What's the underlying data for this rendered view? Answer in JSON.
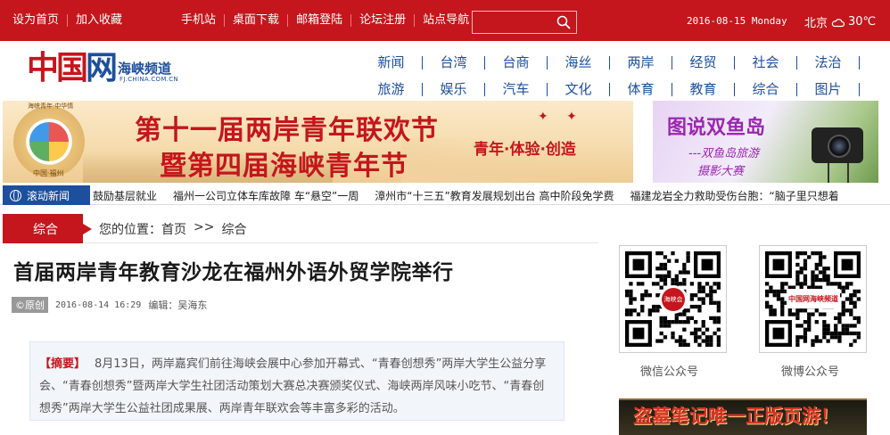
{
  "topbar": {
    "links_left": [
      "设为首页",
      "加入收藏"
    ],
    "links_right": [
      "手机站",
      "桌面下载",
      "邮箱登陆",
      "论坛注册",
      "站点导航"
    ],
    "search_placeholder": "",
    "date": "2016-08-15 Monday",
    "city": "北京",
    "temperature": "30℃",
    "weather_icon": "cloud-icon"
  },
  "logo": {
    "main": "中国",
    "wang": "网",
    "channel": "海峡频道",
    "domain": "FJ.CHINA.COM.CN"
  },
  "nav": {
    "row1": [
      "新闻",
      "台湾",
      "台商",
      "海丝",
      "两岸",
      "经贸",
      "社会",
      "法治"
    ],
    "row2": [
      "旅游",
      "娱乐",
      "汽车",
      "文化",
      "体育",
      "教育",
      "综合",
      "图片"
    ]
  },
  "banner_main": {
    "line1": "第十一届两岸青年联欢节",
    "line2": "暨第四届海峡青年节",
    "slogan": "青年·体验·创造",
    "emblem_top": "海峡青年·中华情",
    "emblem_caption": "中国·福州"
  },
  "banner_side": {
    "title": "图说双鱼岛",
    "sub1": "---双鱼岛旅游",
    "sub2": "摄影大赛"
  },
  "ticker": {
    "label": "滚动新闻",
    "items": [
      "鼓励基层就业",
      "福州一公司立体车库故障 车“悬空”一周",
      "漳州市“十三五”教育发展规划出台 高中阶段免学费",
      "福建龙岩全力救助受伤台胞：“脑子里只想着"
    ]
  },
  "section": {
    "label": "综合",
    "location_prefix": "您的位置：",
    "home": "首页",
    "sep": ">>",
    "current": "综合"
  },
  "article": {
    "title": "首届两岸青年教育沙龙在福州外语外贸学院举行",
    "source": "©原创",
    "time": "2016-08-14 16:29",
    "editor": "编辑：吴海东",
    "summary_label": "【摘要】",
    "summary_text": "8月13日，两岸嘉宾们前往海峡会展中心参加开幕式、“青春创想秀”两岸大学生公益分享会、“青春创想秀”暨两岸大学生社团活动策划大赛总决赛颁奖仪式、海峡两岸风味小吃节、“青春创想秀”两岸大学生公益社团成果展、两岸青年联欢会等丰富多彩的活动。"
  },
  "right": {
    "qr1_caption": "微信公众号",
    "qr2_caption": "微博公众号",
    "qr1_badge": "海峡会",
    "qr2_badge": "中国网海峡频道",
    "ad_text": "盗墓笔记唯一正版页游！"
  },
  "colors": {
    "brand_red": "#c4161c",
    "nav_blue": "#1d4f9c"
  }
}
